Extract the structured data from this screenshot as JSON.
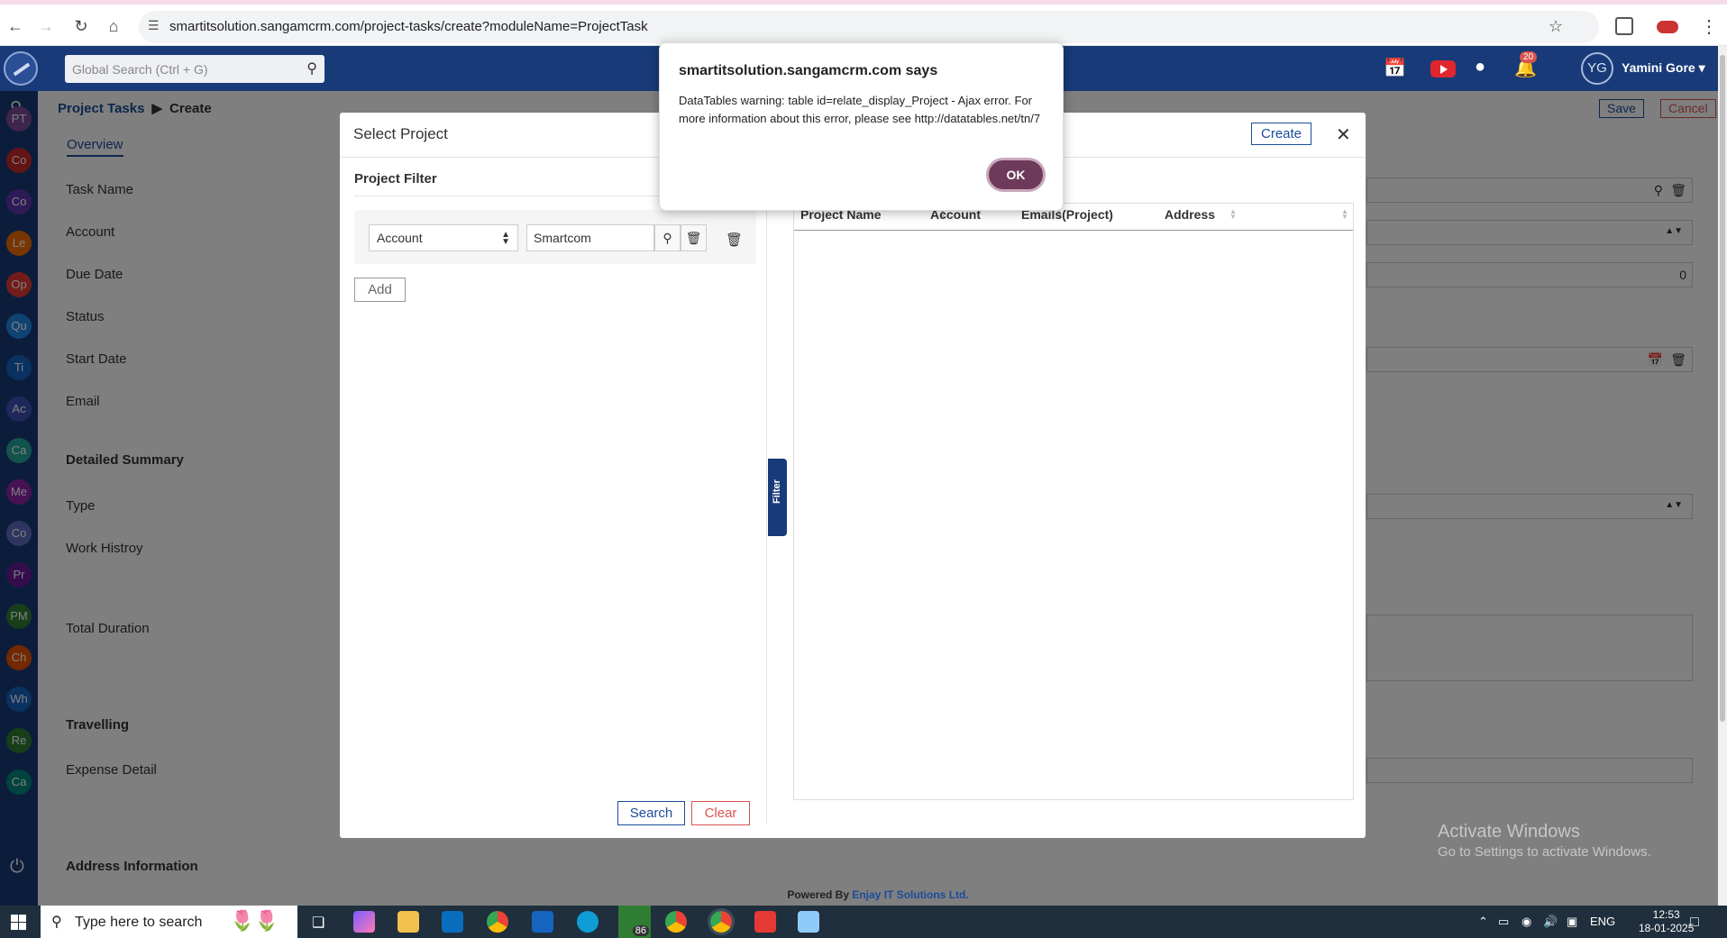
{
  "browser": {
    "url": "smartitsolution.sangamcrm.com/project-tasks/create?moduleName=ProjectTask"
  },
  "header": {
    "search_placeholder": "Global Search (Ctrl + G)",
    "notification_count": "20",
    "user_initials": "YG",
    "user_name": "Yamini Gore ▾"
  },
  "sidebar": {
    "items": [
      {
        "label": "PT",
        "color": "#7b4a9a"
      },
      {
        "label": "Co",
        "color": "#c62828"
      },
      {
        "label": "Co",
        "color": "#5e35b1"
      },
      {
        "label": "Le",
        "color": "#ef6c00"
      },
      {
        "label": "Op",
        "color": "#e53935"
      },
      {
        "label": "Qu",
        "color": "#1e88e5"
      },
      {
        "label": "Ti",
        "color": "#1565c0"
      },
      {
        "label": "Ac",
        "color": "#3f51b5"
      },
      {
        "label": "Ca",
        "color": "#26a69a"
      },
      {
        "label": "Me",
        "color": "#8e24aa"
      },
      {
        "label": "Co",
        "color": "#5c6bc0"
      },
      {
        "label": "Pr",
        "color": "#6a1b9a"
      },
      {
        "label": "PM",
        "color": "#2e7d32"
      },
      {
        "label": "Ch",
        "color": "#e65100"
      },
      {
        "label": "Wh",
        "color": "#1565c0"
      },
      {
        "label": "Re",
        "color": "#2e7d32"
      },
      {
        "label": "Ca",
        "color": "#00897b"
      }
    ]
  },
  "page": {
    "breadcrumb_root": "Project Tasks",
    "breadcrumb_current": "Create",
    "save_label": "Save",
    "cancel_label": "Cancel",
    "tab_overview": "Overview",
    "fields": {
      "task_name": "Task Name",
      "account": "Account",
      "due_date": "Due Date",
      "status": "Status",
      "start_date": "Start Date",
      "email": "Email",
      "detailed_summary": "Detailed Summary",
      "type": "Type",
      "work_history": "Work Histroy",
      "total_duration": "Total Duration",
      "travelling": "Travelling",
      "expense_detail": "Expense Detail",
      "address_information": "Address Information"
    },
    "due_date_value": "0"
  },
  "modal": {
    "title": "Select Project",
    "create_label": "Create",
    "filter_title": "Project Filter",
    "filter_field": "Account",
    "filter_value": "Smartcom",
    "add_label": "Add",
    "filter_tab": "Filter",
    "search_label": "Search",
    "clear_label": "Clear",
    "columns": [
      "Project Name",
      "Account",
      "Emails(Project)",
      "Address"
    ]
  },
  "alert": {
    "title": "smartitsolution.sangamcrm.com says",
    "message": "DataTables warning: table id=relate_display_Project - Ajax error. For more information about this error, please see http://datatables.net/tn/7",
    "ok_label": "OK"
  },
  "footer": {
    "prefix": "Powered By ",
    "brand": "Enjay IT Solutions Ltd."
  },
  "watermark": {
    "line1": "Activate Windows",
    "line2": "Go to Settings to activate Windows."
  },
  "taskbar": {
    "search_placeholder": "Type here to search",
    "whatsapp_badge": "86",
    "language": "ENG",
    "time": "12:53",
    "date": "18-01-2025"
  }
}
